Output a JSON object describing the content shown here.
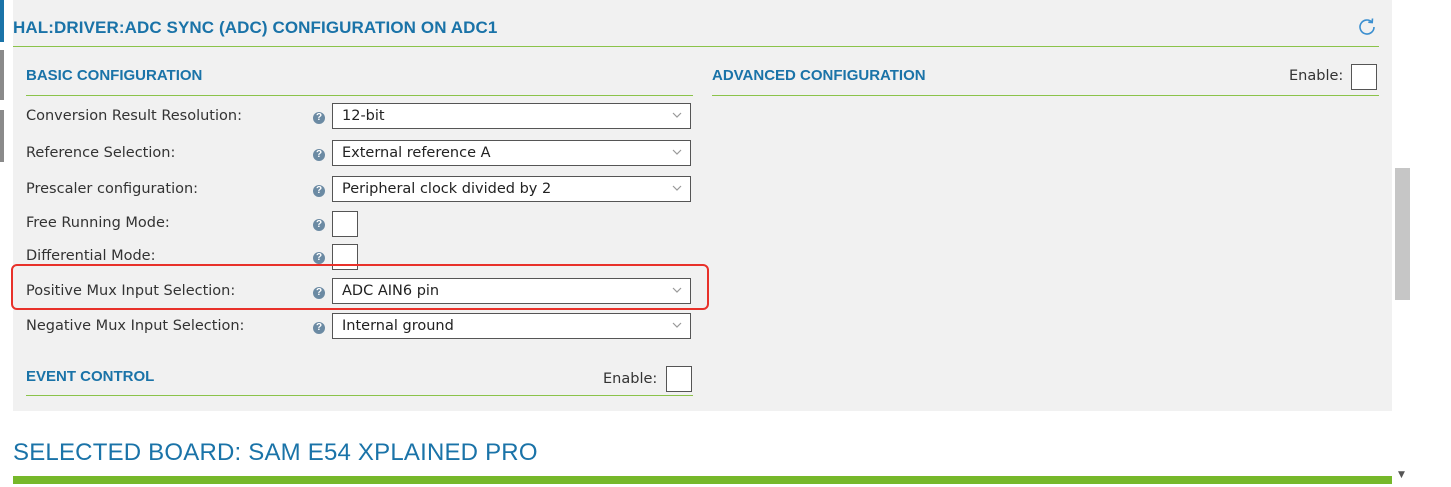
{
  "header": {
    "title": "HAL:DRIVER:ADC SYNC (ADC) CONFIGURATION ON ADC1",
    "refresh_icon": "refresh-icon"
  },
  "basic": {
    "title": "BASIC CONFIGURATION",
    "rows": [
      {
        "label": "Conversion Result Resolution:",
        "type": "select",
        "value": "12-bit"
      },
      {
        "label": "Reference Selection:",
        "type": "select",
        "value": "External reference A"
      },
      {
        "label": "Prescaler configuration:",
        "type": "select",
        "value": "Peripheral clock divided by 2"
      },
      {
        "label": "Free Running Mode:",
        "type": "checkbox",
        "checked": false
      },
      {
        "label": "Differential Mode:",
        "type": "checkbox",
        "checked": false
      },
      {
        "label": "Positive Mux Input Selection:",
        "type": "select",
        "value": "ADC AIN6 pin"
      },
      {
        "label": "Negative Mux Input Selection:",
        "type": "select",
        "value": "Internal ground"
      }
    ]
  },
  "advanced": {
    "title": "ADVANCED CONFIGURATION",
    "enable_label": "Enable:",
    "enabled": false
  },
  "event": {
    "title": "EVENT CONTROL",
    "enable_label": "Enable:",
    "enabled": false
  },
  "board": {
    "title": "SELECTED BOARD: SAM E54 XPLAINED PRO"
  },
  "colors": {
    "accent_blue": "#1a73a8",
    "green": "#8bc34a",
    "highlight_red": "#e8312a"
  }
}
